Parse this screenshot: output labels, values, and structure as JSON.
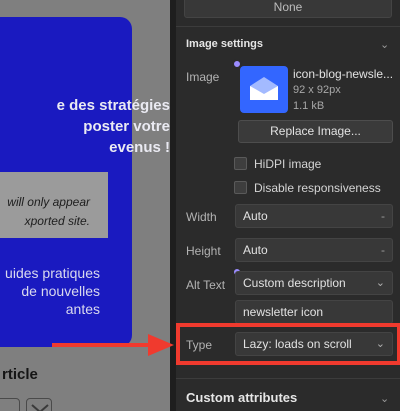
{
  "canvas": {
    "headline_lines": [
      "e des stratégies",
      "poster votre",
      "evenus !"
    ],
    "notice_lines": [
      "will only appear",
      "xported site."
    ],
    "subtext_lines": [
      "uides pratiques",
      "de nouvelles",
      "antes"
    ],
    "article_heading": "rticle"
  },
  "panel": {
    "top_value": "None",
    "image_settings": {
      "title": "Image settings",
      "image_label": "Image",
      "file_name": "icon-blog-newsle...",
      "file_dims": "92 x 92px",
      "file_size": "1.1 kB",
      "replace_button": "Replace Image...",
      "hidpi_label": "HiDPI image",
      "disable_resp_label": "Disable responsiveness",
      "width_label": "Width",
      "width_value": "Auto",
      "height_label": "Height",
      "height_value": "Auto",
      "alt_label": "Alt Text",
      "alt_mode": "Custom description",
      "alt_value": "newsletter icon",
      "type_label": "Type",
      "type_value": "Lazy: loads on scroll"
    },
    "custom_attributes": {
      "title": "Custom attributes"
    }
  },
  "colors": {
    "card_blue": "#1a1ac0",
    "thumb_blue": "#3366ff",
    "highlight_red": "#f03a2e",
    "accent_dot": "#9b8cff"
  },
  "icons": {
    "chevron": "chevron-down-icon",
    "envelope": "envelope-icon",
    "arrow": "arrow-right-icon"
  }
}
